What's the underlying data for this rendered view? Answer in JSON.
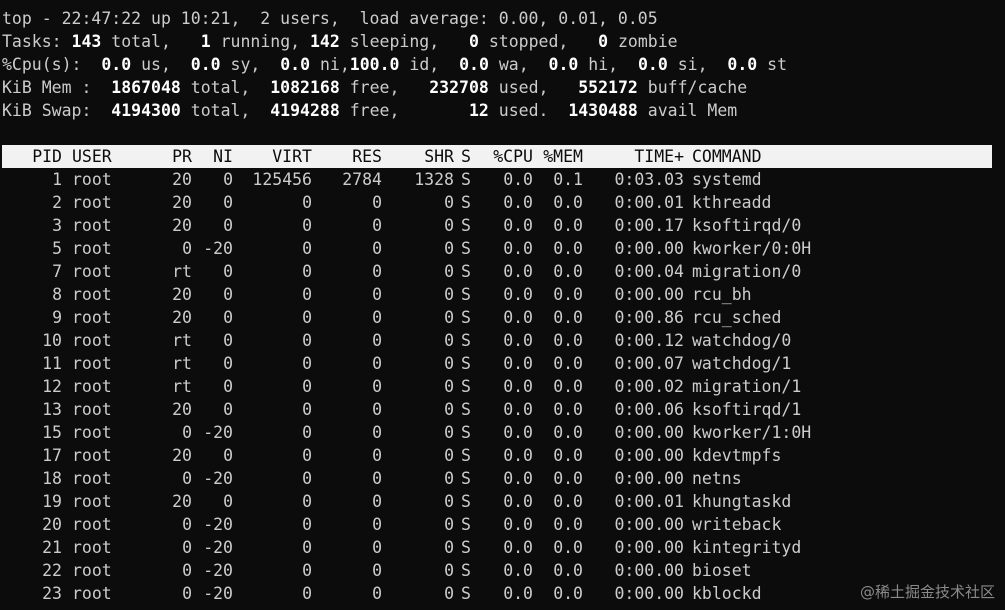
{
  "summary": {
    "line1": "top - 22:47:22 up 10:21,  2 users,  load average: 0.00, 0.01, 0.05",
    "tasks": {
      "label": "Tasks:",
      "total": "143",
      "t_total": " total,",
      "running": "1",
      "t_running": " running,",
      "sleeping": "142",
      "t_sleeping": " sleeping,",
      "stopped": "0",
      "t_stopped": " stopped,",
      "zombie": "0",
      "t_zombie": " zombie"
    },
    "cpu": {
      "label": "%Cpu(s):",
      "us": "0.0",
      "t_us": " us,",
      "sy": "0.0",
      "t_sy": " sy,",
      "ni": "0.0",
      "t_ni": " ni,",
      "id": "100.0",
      "t_id": " id,",
      "wa": "0.0",
      "t_wa": " wa,",
      "hi": "0.0",
      "t_hi": " hi,",
      "si": "0.0",
      "t_si": " si,",
      "st": "0.0",
      "t_st": " st"
    },
    "mem": {
      "label": "KiB Mem :",
      "total": "1867048",
      "t_total": " total,",
      "free": "1082168",
      "t_free": " free,",
      "used": "232708",
      "t_used": " used,",
      "buff": "552172",
      "t_buff": " buff/cache"
    },
    "swap": {
      "label": "KiB Swap:",
      "total": "4194300",
      "t_total": " total,",
      "free": "4194288",
      "t_free": " free,",
      "used": "12",
      "t_used": " used.",
      "avail": "1430488",
      "t_avail": " avail Mem"
    }
  },
  "columns": {
    "pid": "PID",
    "user": "USER",
    "pr": "PR",
    "ni": "NI",
    "virt": "VIRT",
    "res": "RES",
    "shr": "SHR",
    "s": "S",
    "cpu": "%CPU",
    "mem": "%MEM",
    "time": "TIME+",
    "cmd": "COMMAND"
  },
  "processes": [
    {
      "pid": "1",
      "user": "root",
      "pr": "20",
      "ni": "0",
      "virt": "125456",
      "res": "2784",
      "shr": "1328",
      "s": "S",
      "cpu": "0.0",
      "mem": "0.1",
      "time": "0:03.03",
      "cmd": "systemd"
    },
    {
      "pid": "2",
      "user": "root",
      "pr": "20",
      "ni": "0",
      "virt": "0",
      "res": "0",
      "shr": "0",
      "s": "S",
      "cpu": "0.0",
      "mem": "0.0",
      "time": "0:00.01",
      "cmd": "kthreadd"
    },
    {
      "pid": "3",
      "user": "root",
      "pr": "20",
      "ni": "0",
      "virt": "0",
      "res": "0",
      "shr": "0",
      "s": "S",
      "cpu": "0.0",
      "mem": "0.0",
      "time": "0:00.17",
      "cmd": "ksoftirqd/0"
    },
    {
      "pid": "5",
      "user": "root",
      "pr": "0",
      "ni": "-20",
      "virt": "0",
      "res": "0",
      "shr": "0",
      "s": "S",
      "cpu": "0.0",
      "mem": "0.0",
      "time": "0:00.00",
      "cmd": "kworker/0:0H"
    },
    {
      "pid": "7",
      "user": "root",
      "pr": "rt",
      "ni": "0",
      "virt": "0",
      "res": "0",
      "shr": "0",
      "s": "S",
      "cpu": "0.0",
      "mem": "0.0",
      "time": "0:00.04",
      "cmd": "migration/0"
    },
    {
      "pid": "8",
      "user": "root",
      "pr": "20",
      "ni": "0",
      "virt": "0",
      "res": "0",
      "shr": "0",
      "s": "S",
      "cpu": "0.0",
      "mem": "0.0",
      "time": "0:00.00",
      "cmd": "rcu_bh"
    },
    {
      "pid": "9",
      "user": "root",
      "pr": "20",
      "ni": "0",
      "virt": "0",
      "res": "0",
      "shr": "0",
      "s": "S",
      "cpu": "0.0",
      "mem": "0.0",
      "time": "0:00.86",
      "cmd": "rcu_sched"
    },
    {
      "pid": "10",
      "user": "root",
      "pr": "rt",
      "ni": "0",
      "virt": "0",
      "res": "0",
      "shr": "0",
      "s": "S",
      "cpu": "0.0",
      "mem": "0.0",
      "time": "0:00.12",
      "cmd": "watchdog/0"
    },
    {
      "pid": "11",
      "user": "root",
      "pr": "rt",
      "ni": "0",
      "virt": "0",
      "res": "0",
      "shr": "0",
      "s": "S",
      "cpu": "0.0",
      "mem": "0.0",
      "time": "0:00.07",
      "cmd": "watchdog/1"
    },
    {
      "pid": "12",
      "user": "root",
      "pr": "rt",
      "ni": "0",
      "virt": "0",
      "res": "0",
      "shr": "0",
      "s": "S",
      "cpu": "0.0",
      "mem": "0.0",
      "time": "0:00.02",
      "cmd": "migration/1"
    },
    {
      "pid": "13",
      "user": "root",
      "pr": "20",
      "ni": "0",
      "virt": "0",
      "res": "0",
      "shr": "0",
      "s": "S",
      "cpu": "0.0",
      "mem": "0.0",
      "time": "0:00.06",
      "cmd": "ksoftirqd/1"
    },
    {
      "pid": "15",
      "user": "root",
      "pr": "0",
      "ni": "-20",
      "virt": "0",
      "res": "0",
      "shr": "0",
      "s": "S",
      "cpu": "0.0",
      "mem": "0.0",
      "time": "0:00.00",
      "cmd": "kworker/1:0H"
    },
    {
      "pid": "17",
      "user": "root",
      "pr": "20",
      "ni": "0",
      "virt": "0",
      "res": "0",
      "shr": "0",
      "s": "S",
      "cpu": "0.0",
      "mem": "0.0",
      "time": "0:00.00",
      "cmd": "kdevtmpfs"
    },
    {
      "pid": "18",
      "user": "root",
      "pr": "0",
      "ni": "-20",
      "virt": "0",
      "res": "0",
      "shr": "0",
      "s": "S",
      "cpu": "0.0",
      "mem": "0.0",
      "time": "0:00.00",
      "cmd": "netns"
    },
    {
      "pid": "19",
      "user": "root",
      "pr": "20",
      "ni": "0",
      "virt": "0",
      "res": "0",
      "shr": "0",
      "s": "S",
      "cpu": "0.0",
      "mem": "0.0",
      "time": "0:00.01",
      "cmd": "khungtaskd"
    },
    {
      "pid": "20",
      "user": "root",
      "pr": "0",
      "ni": "-20",
      "virt": "0",
      "res": "0",
      "shr": "0",
      "s": "S",
      "cpu": "0.0",
      "mem": "0.0",
      "time": "0:00.00",
      "cmd": "writeback"
    },
    {
      "pid": "21",
      "user": "root",
      "pr": "0",
      "ni": "-20",
      "virt": "0",
      "res": "0",
      "shr": "0",
      "s": "S",
      "cpu": "0.0",
      "mem": "0.0",
      "time": "0:00.00",
      "cmd": "kintegrityd"
    },
    {
      "pid": "22",
      "user": "root",
      "pr": "0",
      "ni": "-20",
      "virt": "0",
      "res": "0",
      "shr": "0",
      "s": "S",
      "cpu": "0.0",
      "mem": "0.0",
      "time": "0:00.00",
      "cmd": "bioset"
    },
    {
      "pid": "23",
      "user": "root",
      "pr": "0",
      "ni": "-20",
      "virt": "0",
      "res": "0",
      "shr": "0",
      "s": "S",
      "cpu": "0.0",
      "mem": "0.0",
      "time": "0:00.00",
      "cmd": "kblockd"
    }
  ],
  "watermark": "@稀土掘金技术社区",
  "colors": {
    "background": "#0c0c0c",
    "text": "#cccccc",
    "bold": "#ffffff",
    "header_bg": "#f2f2f2",
    "header_text": "#0c0c0c"
  }
}
